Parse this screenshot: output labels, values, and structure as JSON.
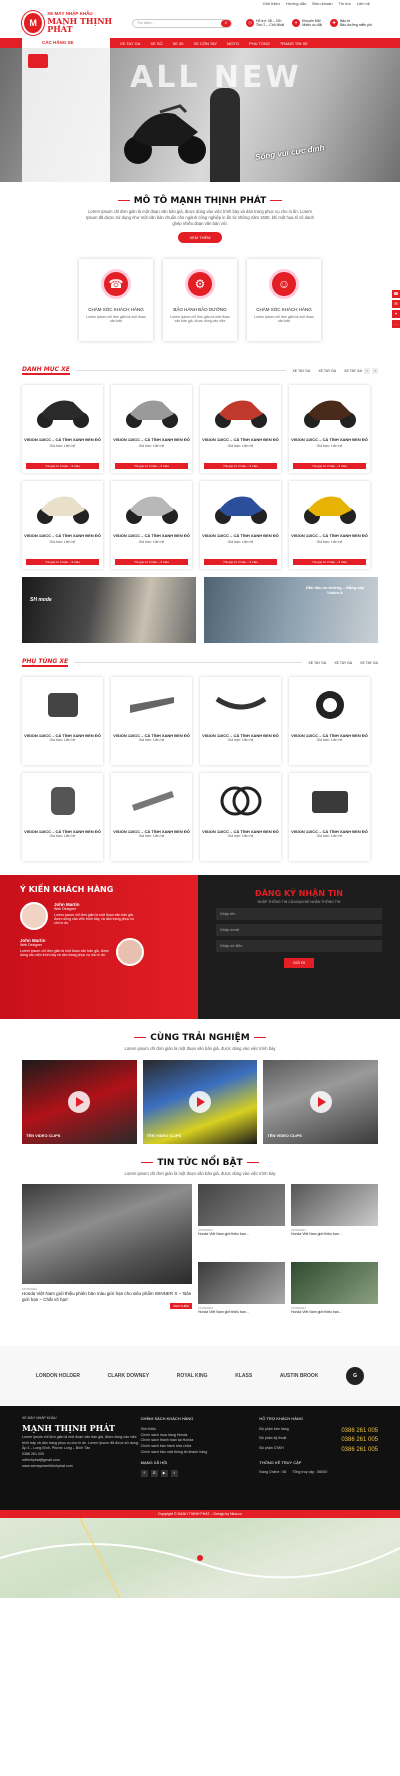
{
  "topbar": [
    "Giới thiệu",
    "Hướng dẫn",
    "Điều khoản",
    "Tin tức",
    "Liên hệ"
  ],
  "logo": {
    "small": "XE MÁY NHẬP KHẨU",
    "big": "MẠNH THỊNH PHÁT"
  },
  "search": {
    "placeholder": "Tìm kiếm..."
  },
  "hinfo": [
    {
      "a": "Hỗ trợ: 08 – 22h",
      "b": "Thứ 2 – Chủ Nhật"
    },
    {
      "a": "Khuyến Mãi",
      "b": "Nhiều ưu đãi"
    },
    {
      "a": "Bảo trì",
      "b": "Bảo dưỡng miễn phí"
    }
  ],
  "nav": {
    "category": "CÁC HÃNG XE",
    "items": [
      "XE TAY GA",
      "XE SỐ",
      "XE 50",
      "XE CÔN TAY",
      "MOTO",
      "PHỤ TÙNG",
      "TRANG TIN XE"
    ]
  },
  "hero": {
    "big": "ALL NEW",
    "slogan": "Sống vui cực đỉnh"
  },
  "about": {
    "title": "MÔ TÔ MẠNH THỊNH PHÁT",
    "desc": "Lorem Ipsum chỉ đơn giản là một đoạn văn bản giả, được dùng vào việc trình bày và dàn trang phục vụ cho in ấn. Lorem Ipsum đã được sử dụng như một văn bản chuẩn cho ngành công nghiệp in ấn từ những năm 1500, khi một họa sĩ vô danh ghép nhiều đoạn văn bản với.",
    "button": "XEM THÊM"
  },
  "services": [
    {
      "title": "CHĂM SÓC KHÁCH HÀNG",
      "desc": "Lorem ipsum chỉ đơn giản là một đoạn văn bản"
    },
    {
      "title": "BẢO HÀNH BẢO DƯỠNG",
      "desc": "Lorem ipsum chỉ đơn giản là một đoạn văn bản giả, được dùng vào việc"
    },
    {
      "title": "CHĂM SÓC KHÁCH HÀNG",
      "desc": "Lorem ipsum chỉ đơn giản là một đoạn văn bản"
    }
  ],
  "catbar": {
    "title": "DANH MỤC XE",
    "tabs": [
      "XE TAY GA",
      "XE TAY GA",
      "XE TAY GA"
    ]
  },
  "products": [
    {
      "name": "VISION 110CC – CÁ TÍNH XANH ĐEN ĐỎ",
      "price": "Giá bán: Liên hệ",
      "tag": "Trả góp từ 3 triệu – 9 triệu",
      "c": "#2a2a2a"
    },
    {
      "name": "VISION 110CC – CÁ TÍNH XANH ĐEN ĐỎ",
      "price": "Giá bán: Liên hệ",
      "tag": "Trả góp từ 3 triệu – 9 triệu",
      "c": "#9a9a9a"
    },
    {
      "name": "VISION 110CC – CÁ TÍNH XANH ĐEN ĐỎ",
      "price": "Giá bán: Liên hệ",
      "tag": "Trả góp từ 3 triệu – 9 triệu",
      "c": "#c0392b"
    },
    {
      "name": "VISION 110CC – CÁ TÍNH XANH ĐEN ĐỎ",
      "price": "Giá bán: Liên hệ",
      "tag": "Trả góp từ 3 triệu – 9 triệu",
      "c": "#4a2a1a"
    },
    {
      "name": "VISION 110CC – CÁ TÍNH XANH ĐEN ĐỎ",
      "price": "Giá bán: Liên hệ",
      "tag": "Trả góp từ 3 triệu – 9 triệu",
      "c": "#e8e0c8"
    },
    {
      "name": "VISION 110CC – CÁ TÍNH XANH ĐEN ĐỎ",
      "price": "Giá bán: Liên hệ",
      "tag": "Trả góp từ 3 triệu – 9 triệu",
      "c": "#b8b8b8"
    },
    {
      "name": "VISION 110CC – CÁ TÍNH XANH ĐEN ĐỎ",
      "price": "Giá bán: Liên hệ",
      "tag": "Trả góp từ 3 triệu – 9 triệu",
      "c": "#2b4f9a"
    },
    {
      "name": "VISION 110CC – CÁ TÍNH XANH ĐEN ĐỎ",
      "price": "Giá bán: Liên hệ",
      "tag": "Trả góp từ 3 triệu – 9 triệu",
      "c": "#e6b400"
    }
  ],
  "banners": [
    "SH mode",
    "Dẫn đầu xu hướng – Đẳng cấp Vision A"
  ],
  "partbar": {
    "title": "PHỤ TÙNG XE",
    "tabs": [
      "XE TAY GA",
      "XE TAY GA",
      "XE TAY GA"
    ]
  },
  "parts": [
    {
      "name": "VISION 110CC – CÁ TÍNH XANH ĐEN ĐỎ",
      "price": "Giá bán: Liên hệ"
    },
    {
      "name": "VISION 110CC – CÁ TÍNH XANH ĐEN ĐỎ",
      "price": "Giá bán: Liên hệ"
    },
    {
      "name": "VISION 110CC – CÁ TÍNH XANH ĐEN ĐỎ",
      "price": "Giá bán: Liên hệ"
    },
    {
      "name": "VISION 110CC – CÁ TÍNH XANH ĐEN ĐỎ",
      "price": "Giá bán: Liên hệ"
    },
    {
      "name": "VISION 110CC – CÁ TÍNH XANH ĐEN ĐỎ",
      "price": "Giá bán: Liên hệ"
    },
    {
      "name": "VISION 110CC – CÁ TÍNH XANH ĐEN ĐỎ",
      "price": "Giá bán: Liên hệ"
    },
    {
      "name": "VISION 110CC – CÁ TÍNH XANH ĐEN ĐỎ",
      "price": "Giá bán: Liên hệ"
    },
    {
      "name": "VISION 110CC – CÁ TÍNH XANH ĐEN ĐỎ",
      "price": "Giá bán: Liên hệ"
    }
  ],
  "testimonial": {
    "title": "Ý KIẾN KHÁCH HÀNG",
    "p1": "John Martin",
    "r1": "Web Designer",
    "t1": "Lorem ipsum chỉ đơn giản là một đoạn văn bản giả, được dùng vào việc trình bày, và dàn trang phục vụ cho in ấn.",
    "p2": "John Martin",
    "r2": "Web Designer",
    "t2": "Lorem ipsum chỉ đơn giản là một đoạn văn bản giả, được dùng vào việc trình bày và dàn trang phục vụ cho in ấn."
  },
  "newsletter": {
    "title": "ĐĂNG KÝ NHẬN TIN",
    "sub": "NHẬP THÔNG TIN CỦA BẠN ĐỂ NHẬN THÔNG TIN",
    "f1": "Nhập tên",
    "f2": "Nhập email",
    "f3": "Nhập số điện",
    "button": "GỬI ĐI"
  },
  "experience": {
    "title": "CÙNG TRẢI NGHIỆM",
    "desc": "Lorem ipsum chỉ đơn giản là một đoạn văn bản giả, được dùng vào việc trình bày",
    "videos": [
      "TÊN VIDEO CLIPS",
      "TÊN VIDEO CLIPS",
      "TÊN VIDEO CLIPS"
    ]
  },
  "newsSec": {
    "title": "TIN TỨC NỔI BẬT",
    "desc": "Lorem ipsum chỉ đơn giản là một đoạn văn bản giả, được dùng vào việc trình bày",
    "bigdate": "27/05/2021",
    "bigtitle": "Honda Việt Nam giới thiệu phiên bản màu giới hạn cho siêu phẩm WINNER X – 'Bản giới hạn – Chất võ hạn'",
    "more": "XEM THÊM",
    "small": [
      {
        "date": "27/05/2021",
        "title": "Honda Việt Nam giới thiệu bạn..."
      },
      {
        "date": "27/05/2021",
        "title": "Honda Việt Nam giới thiệu bạn..."
      },
      {
        "date": "27/05/2021",
        "title": "Honda Việt Nam giới thiệu bạn..."
      },
      {
        "date": "27/05/2021",
        "title": "Honda Việt Nam giới thiệu bạn..."
      }
    ]
  },
  "brands": [
    "LONDON HOLDER",
    "CLARK DOWNEY",
    "ROYAL KING",
    "KLASS",
    "AUSTIN BROOK",
    "G"
  ],
  "footer": {
    "small": "XE MÁY NHẬP KHẨU",
    "big": "MẠNH THỊNH PHÁT",
    "desc": "Lorem ipsum chỉ đơn giản là một đoạn văn bản giả, được dùng vào việc trình bày và dàn trang phục vụ cho in ấn. Lorem Ipsum đã được sử dụng.",
    "addr": "Ấp 3 – Long Bình, Phước Long – Bình Tân",
    "phone": "0386 261 005",
    "email": "mthinhphat@gmail.com",
    "web": "www.xemaymanhthinhphat.com",
    "policyTitle": "CHÍNH SÁCH KHÁCH HÀNG",
    "policies": [
      "Giới thiệu",
      "Chính sách mua hàng Honda",
      "Chính sách thanh toán tại Honda",
      "Chính sách bảo hành sửa chữa",
      "Chính sách bảo mật thông tin khách hàng"
    ],
    "socialTitle": "MẠNG XÃ HỘI",
    "supportTitle": "HỖ TRỢ KHÁCH HÀNG",
    "support": [
      {
        "label": "Bộ phận bán hàng",
        "phone": "0386 261 005"
      },
      {
        "label": "Bộ phận kỹ thuật",
        "phone": "0386 261 005"
      },
      {
        "label": "Bộ phận CSKH",
        "phone": "0386 261 005"
      }
    ],
    "statTitle": "THỐNG KÊ TRUY CẬP",
    "online": "Đang Online : 56",
    "total": "Tổng truy cập : 56000"
  },
  "copyright": "Copyright © MẠNH THỊNH PHÁT – Design by Nina.co"
}
